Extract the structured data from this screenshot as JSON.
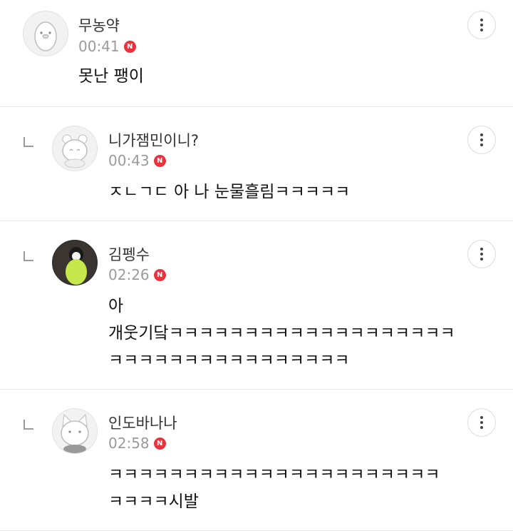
{
  "comments": [
    {
      "nickname": "무농약",
      "time": "00:41",
      "badge": "N",
      "text": "못난 팽이",
      "avatar": "penguin-avatar",
      "is_reply": false
    },
    {
      "nickname": "니가잼민이니?",
      "time": "00:43",
      "badge": "N",
      "text": "ㅈㄴㄱㄷ 아 나 눈물흘림ㅋㅋㅋㅋㅋ",
      "avatar": "hamster-avatar",
      "is_reply": true
    },
    {
      "nickname": "김펭수",
      "time": "02:26",
      "badge": "N",
      "text": "아\n개웃기닼ㅋㅋㅋㅋㅋㅋㅋㅋㅋㅋㅋㅋㅋㅋㅋㅋㅋㅋㅋ\nㅋㅋㅋㅋㅋㅋㅋㅋㅋㅋㅋㅋㅋㅋㅋㅋ",
      "avatar": "photo-avatar",
      "is_reply": true
    },
    {
      "nickname": "인도바나나",
      "time": "02:58",
      "badge": "N",
      "text": "ㅋㅋㅋㅋㅋㅋㅋㅋㅋㅋㅋㅋㅋㅋㅋㅋㅋㅋㅋㅋㅋㅋ\nㅋㅋㅋㅋ시발",
      "avatar": "cat-avatar",
      "is_reply": true
    }
  ]
}
